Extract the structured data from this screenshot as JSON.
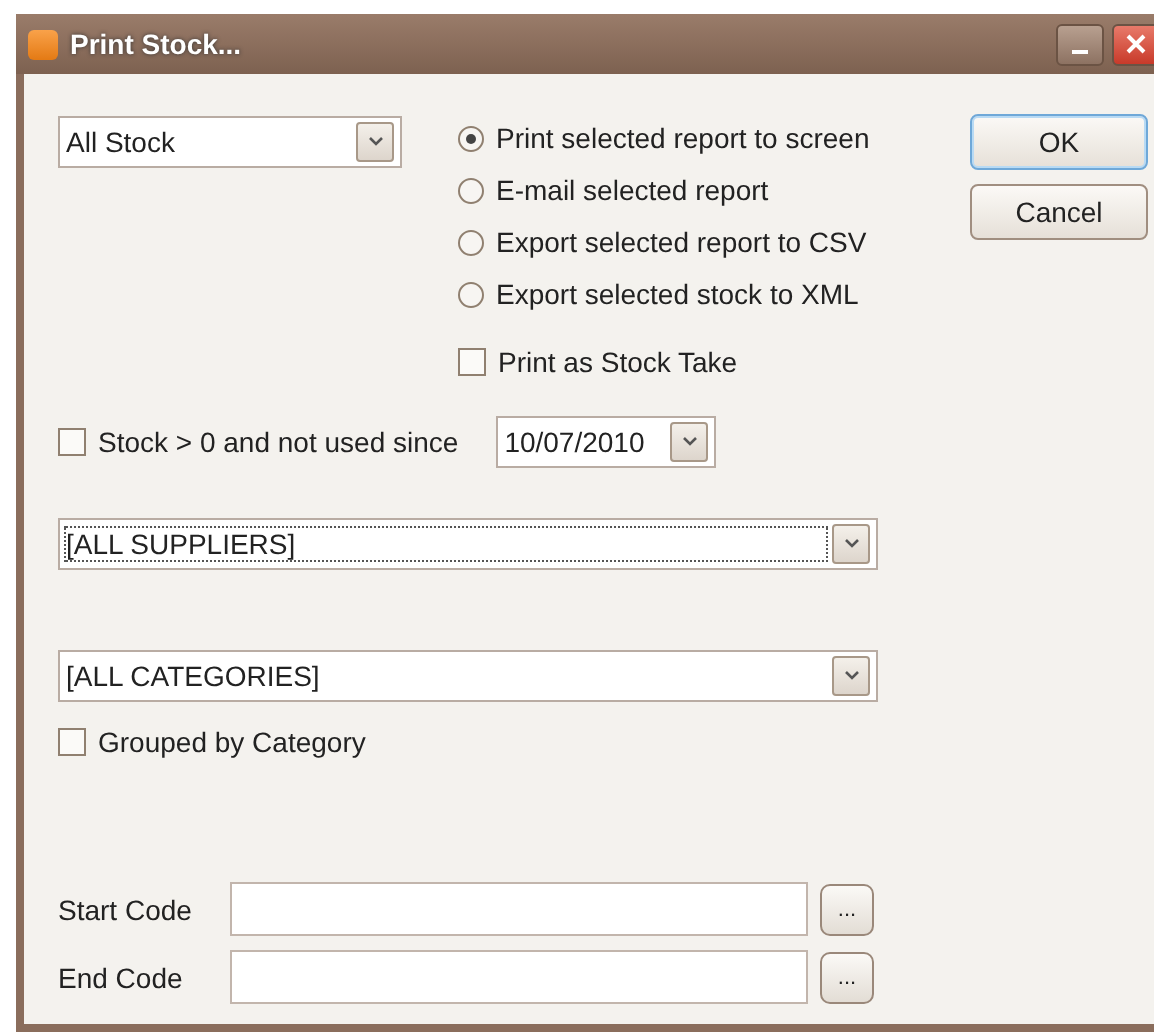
{
  "window": {
    "title": "Print Stock..."
  },
  "report_type": {
    "value": "All Stock"
  },
  "output_options": [
    {
      "label": "Print selected report to screen",
      "selected": true
    },
    {
      "label": "E-mail selected report",
      "selected": false
    },
    {
      "label": "Export selected report to CSV",
      "selected": false
    },
    {
      "label": "Export selected stock to XML",
      "selected": false
    }
  ],
  "stock_take": {
    "label": "Print as Stock Take",
    "checked": false
  },
  "buttons": [
    {
      "label": "OK",
      "default": true
    },
    {
      "label": "Cancel",
      "default": false
    }
  ],
  "unused_filter": {
    "label": "Stock > 0 and not used since",
    "checked": false,
    "date": "10/07/2010"
  },
  "supplier": {
    "value": "[ALL SUPPLIERS]"
  },
  "category": {
    "value": "[ALL CATEGORIES]"
  },
  "grouped": {
    "label": "Grouped by Category",
    "checked": false
  },
  "code_fields": [
    {
      "label": "Start Code",
      "browse": "..."
    },
    {
      "label": "End Code",
      "browse": "..."
    }
  ]
}
